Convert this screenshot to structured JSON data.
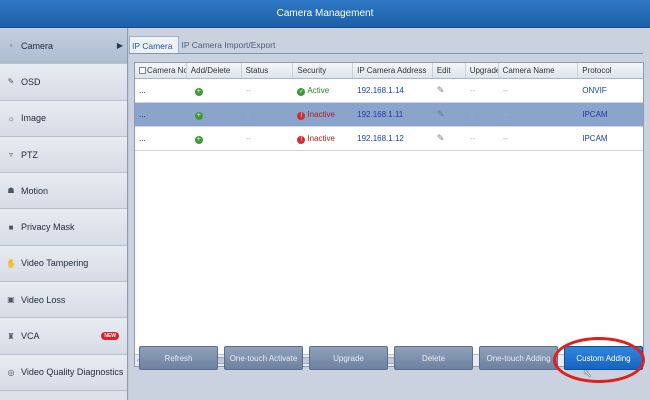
{
  "window": {
    "title": "Camera Management"
  },
  "sidebar": {
    "items": [
      {
        "label": "Camera",
        "icon": "camera-icon",
        "active": true
      },
      {
        "label": "OSD",
        "icon": "osd-icon"
      },
      {
        "label": "Image",
        "icon": "image-icon"
      },
      {
        "label": "PTZ",
        "icon": "ptz-icon"
      },
      {
        "label": "Motion",
        "icon": "motion-icon"
      },
      {
        "label": "Privacy Mask",
        "icon": "privacy-mask-icon"
      },
      {
        "label": "Video Tampering",
        "icon": "tampering-icon"
      },
      {
        "label": "Video Loss",
        "icon": "video-loss-icon"
      },
      {
        "label": "VCA",
        "icon": "vca-icon",
        "badge": "NEW"
      },
      {
        "label": "Video Quality Diagnostics",
        "icon": "diagnostics-icon"
      }
    ]
  },
  "tabs": [
    {
      "label": "IP Camera",
      "active": true
    },
    {
      "label": "IP Camera Import/Export"
    }
  ],
  "table": {
    "columns": [
      "Camera No.",
      "Add/Delete",
      "Status",
      "Security",
      "IP Camera Address",
      "Edit",
      "Upgrade",
      "Camera Name",
      "Protocol"
    ],
    "rows": [
      {
        "camera_no": "...",
        "status": "--",
        "security": "Active",
        "ip": "192.168.1.14",
        "upgrade": "--",
        "name": "--",
        "protocol": "ONVIF"
      },
      {
        "camera_no": "...",
        "status": "--",
        "security": "Inactive",
        "ip": "192.168.1.11",
        "upgrade": "--",
        "name": "--",
        "protocol": "IPCAM"
      },
      {
        "camera_no": "...",
        "status": "--",
        "security": "Inactive",
        "ip": "192.168.1.12",
        "upgrade": "--",
        "name": "--",
        "protocol": "IPCAM"
      }
    ]
  },
  "buttons": {
    "refresh": "Refresh",
    "activate": "One-touch Activate",
    "upgrade": "Upgrade",
    "delete": "Delete",
    "one_touch_adding": "One-touch Adding",
    "custom_adding": "Custom Adding"
  },
  "colors": {
    "accent": "#1f6fc9",
    "highlight": "#e21d1d",
    "active": "#3e9a3a",
    "inactive": "#d03030"
  }
}
